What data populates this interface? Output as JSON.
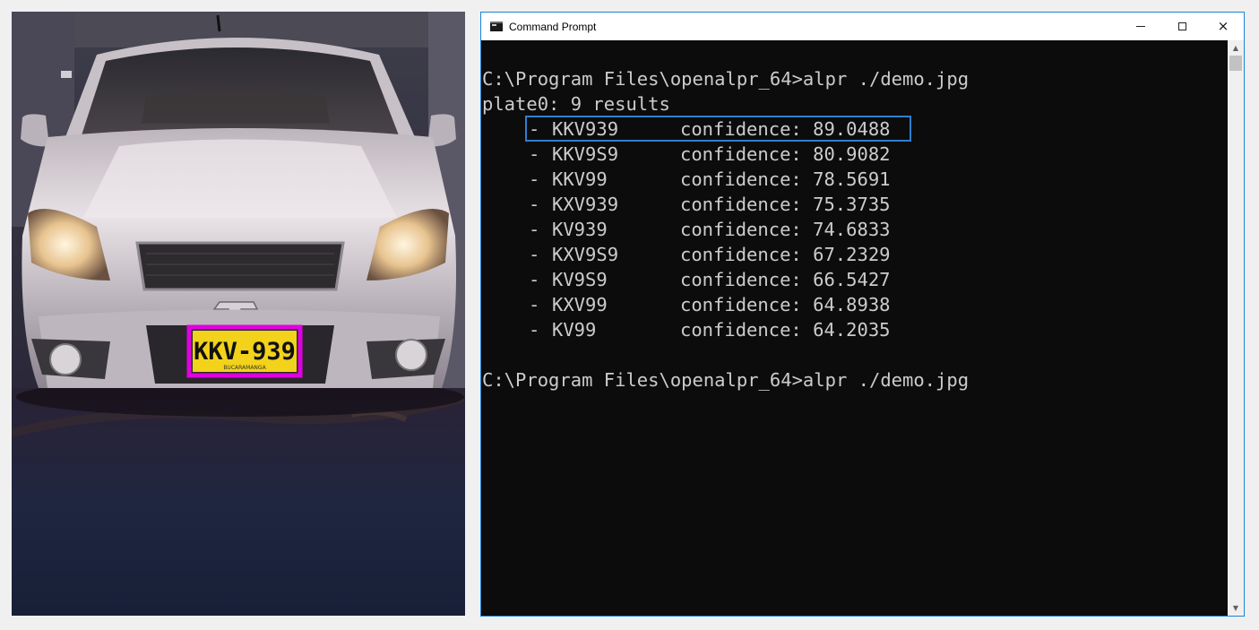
{
  "photo": {
    "plate_text": "KKV-939",
    "plate_city": "BUCARAMANGA",
    "colors": {
      "plate_box": "#e000e0",
      "plate_bg": "#f2d21a"
    }
  },
  "window": {
    "title": "Command Prompt",
    "icon": "console-icon",
    "controls": {
      "minimize": "minimize-icon",
      "maximize": "maximize-icon",
      "close": "×"
    }
  },
  "console": {
    "command_line": "C:\\Program Files\\openalpr_64>alpr ./demo.jpg",
    "summary": "plate0: 9 results",
    "results": [
      {
        "bullet": "-",
        "plate": "KKV939",
        "confidence": "confidence: 89.0488"
      },
      {
        "bullet": "-",
        "plate": "KKV9S9",
        "confidence": "confidence: 80.9082"
      },
      {
        "bullet": "-",
        "plate": "KKV99",
        "confidence": "confidence: 78.5691"
      },
      {
        "bullet": "-",
        "plate": "KXV939",
        "confidence": "confidence: 75.3735"
      },
      {
        "bullet": "-",
        "plate": "KV939",
        "confidence": "confidence: 74.6833"
      },
      {
        "bullet": "-",
        "plate": "KXV9S9",
        "confidence": "confidence: 67.2329"
      },
      {
        "bullet": "-",
        "plate": "KV9S9",
        "confidence": "confidence: 66.5427"
      },
      {
        "bullet": "-",
        "plate": "KXV99",
        "confidence": "confidence: 64.8938"
      },
      {
        "bullet": "-",
        "plate": "KV99",
        "confidence": "confidence: 64.2035"
      }
    ],
    "prompt_line": "C:\\Program Files\\openalpr_64>alpr ./demo.jpg",
    "highlight_color": "#2f7fd0",
    "text_color": "#cccccc",
    "background": "#0c0c0c"
  },
  "scrollbar": {
    "up": "▲",
    "down": "▼"
  }
}
